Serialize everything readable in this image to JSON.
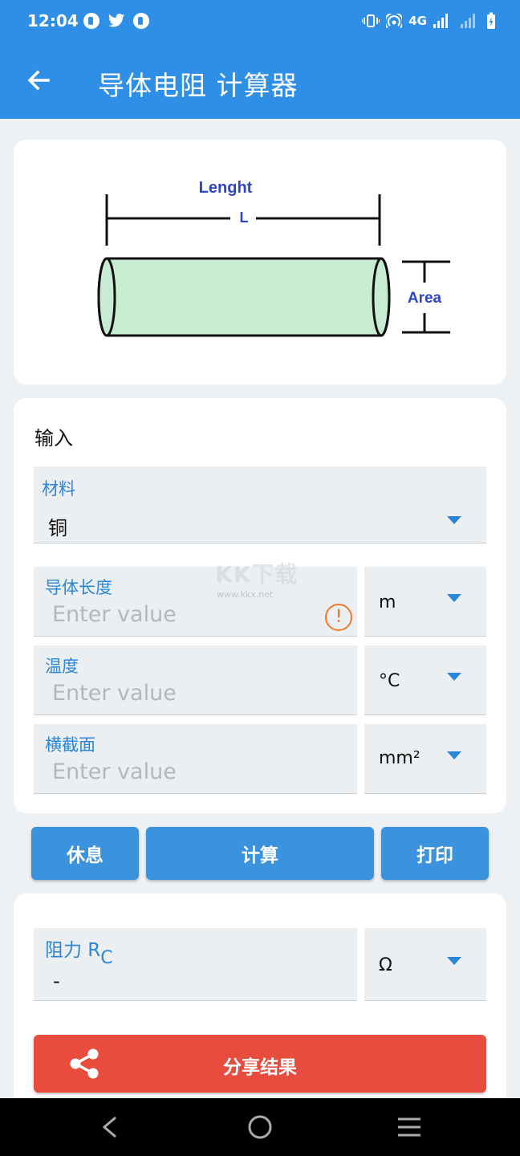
{
  "status_bar": {
    "time": "12:04",
    "network": "4G",
    "left_icons": [
      "notification-icon",
      "twitter-icon",
      "notification-icon"
    ],
    "right_icons": [
      "vibrate-icon",
      "hotspot-icon",
      "signal-icon",
      "signal-icon",
      "battery-charging-icon"
    ]
  },
  "app_bar": {
    "back_icon": "arrow-left-icon",
    "title": "导体电阻 计算器"
  },
  "diagram": {
    "length_label": "Lenght",
    "length_symbol": "L",
    "area_label": "Area",
    "colors": {
      "label": "#2d44c9",
      "cylinder_fill": "#c8ecd2"
    }
  },
  "input": {
    "section_title": "输入",
    "material": {
      "label": "材料",
      "value": "铜"
    },
    "length": {
      "label": "导体长度",
      "placeholder": "Enter value",
      "unit": "m",
      "warning_icon": "exclamation-circle-icon"
    },
    "temperature": {
      "label": "温度",
      "placeholder": "Enter value",
      "unit": "°C"
    },
    "cross_section": {
      "label": "横截面",
      "placeholder": "Enter value",
      "unit": "mm²"
    }
  },
  "buttons": {
    "reset": "休息",
    "calculate": "计算",
    "print": "打印"
  },
  "result": {
    "label": "阻力 R",
    "label_sub": "C",
    "value": "-",
    "unit": "Ω"
  },
  "share": {
    "label": "分享结果",
    "icon": "share-icon"
  },
  "watermark": {
    "text": "KK下载",
    "url": "www.kkx.net"
  },
  "nav_bar": {
    "icons": [
      "back-triangle-icon",
      "home-circle-icon",
      "menu-icon"
    ]
  },
  "colors": {
    "primary": "#2f8fe6",
    "button": "#3a93dc",
    "share": "#e84c3d",
    "label": "#2a86d8",
    "warning": "#f07a2a"
  }
}
